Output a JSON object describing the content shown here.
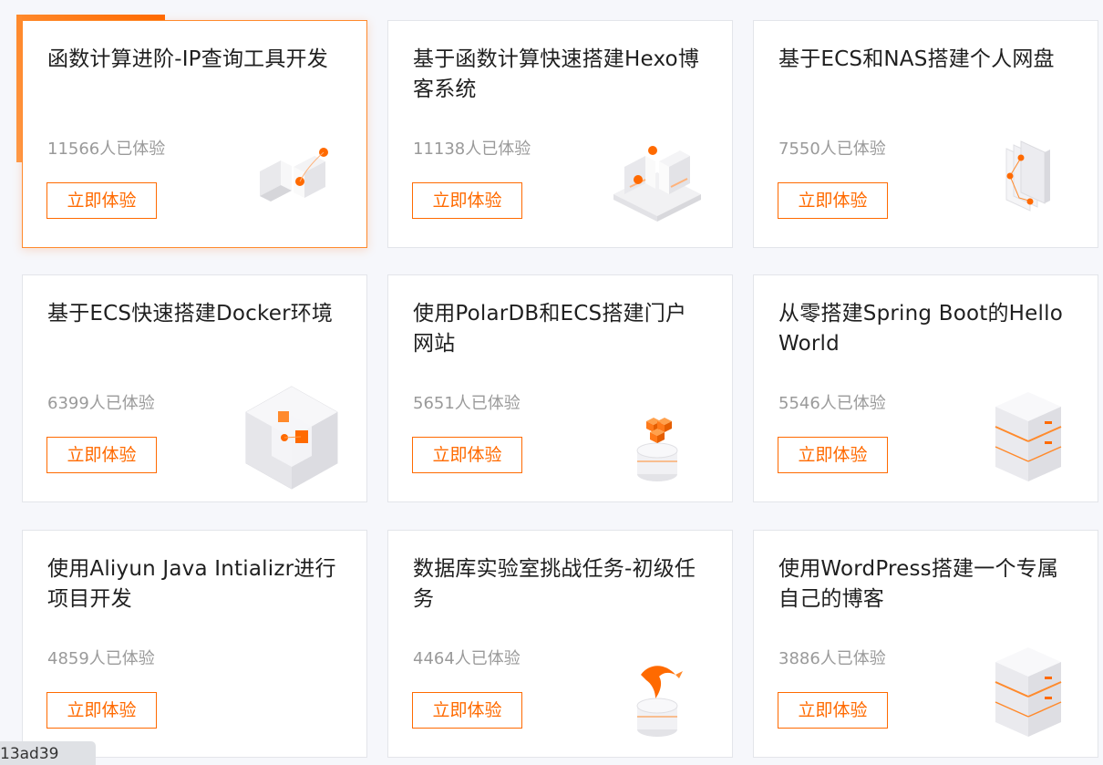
{
  "accent_color": "#ff6a00",
  "cards": [
    {
      "title": "函数计算进阶-IP查询工具开发",
      "count": "11566人已体验",
      "button": "立即体验",
      "icon": "function-compute-icon"
    },
    {
      "title": "基于函数计算快速搭建Hexo博客系统",
      "count": "11138人已体验",
      "button": "立即体验",
      "icon": "function-compute-platform-icon"
    },
    {
      "title": "基于ECS和NAS搭建个人网盘",
      "count": "7550人已体验",
      "button": "立即体验",
      "icon": "storage-panels-icon"
    },
    {
      "title": "基于ECS快速搭建Docker环境",
      "count": "6399人已体验",
      "button": "立即体验",
      "icon": "container-cube-icon"
    },
    {
      "title": "使用PolarDB和ECS搭建门户网站",
      "count": "5651人已体验",
      "button": "立即体验",
      "icon": "database-blocks-icon"
    },
    {
      "title": "从零搭建Spring Boot的Hello World",
      "count": "5546人已体验",
      "button": "立即体验",
      "icon": "server-stack-icon"
    },
    {
      "title": "使用Aliyun Java Intializr进行项目开发",
      "count": "4859人已体验",
      "button": "立即体验",
      "icon": "server-stack-icon"
    },
    {
      "title": "数据库实验室挑战任务-初级任务",
      "count": "4464人已体验",
      "button": "立即体验",
      "icon": "database-dolphin-icon"
    },
    {
      "title": "使用WordPress搭建一个专属自己的博客",
      "count": "3886人已体验",
      "button": "立即体验",
      "icon": "server-stack-icon"
    }
  ],
  "status_tooltip": "13ad39"
}
